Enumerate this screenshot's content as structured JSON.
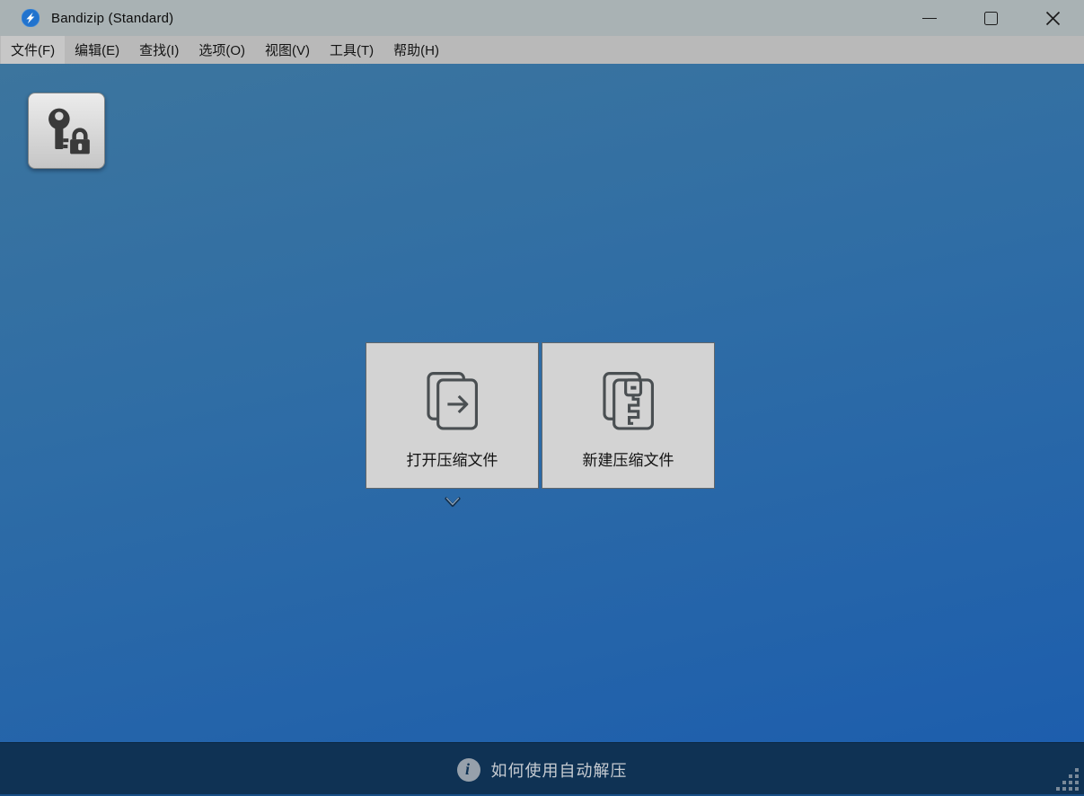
{
  "window": {
    "title": "Bandizip (Standard)",
    "icon": "bandizip-logo-icon",
    "controls": {
      "minimize": "minimize-icon",
      "maximize": "maximize-icon",
      "close": "close-icon"
    }
  },
  "menubar": {
    "items": [
      {
        "label": "文件(F)"
      },
      {
        "label": "编辑(E)"
      },
      {
        "label": "查找(I)"
      },
      {
        "label": "选项(O)"
      },
      {
        "label": "视图(V)"
      },
      {
        "label": "工具(T)"
      },
      {
        "label": "帮助(H)"
      }
    ]
  },
  "toolbar": {
    "password_manager_icon": "key-lock-icon"
  },
  "main": {
    "open_archive_label": "打开压缩文件",
    "new_archive_label": "新建压缩文件",
    "more_icon": "chevron-down-icon"
  },
  "statusbar": {
    "info_icon": "info-icon",
    "tip_text": "如何使用自动解压"
  },
  "colors": {
    "titlebar_bg": "#A9B2B4",
    "menubar_bg": "#B9B9B9",
    "main_gradient_top": "#3C759E",
    "main_gradient_bottom": "#1D5EAD",
    "big_button_bg": "#D3D3D3",
    "statusbar_bg": "#0F3254",
    "logo_blue": "#2173CE",
    "icon_stroke": "#4A4F52"
  }
}
